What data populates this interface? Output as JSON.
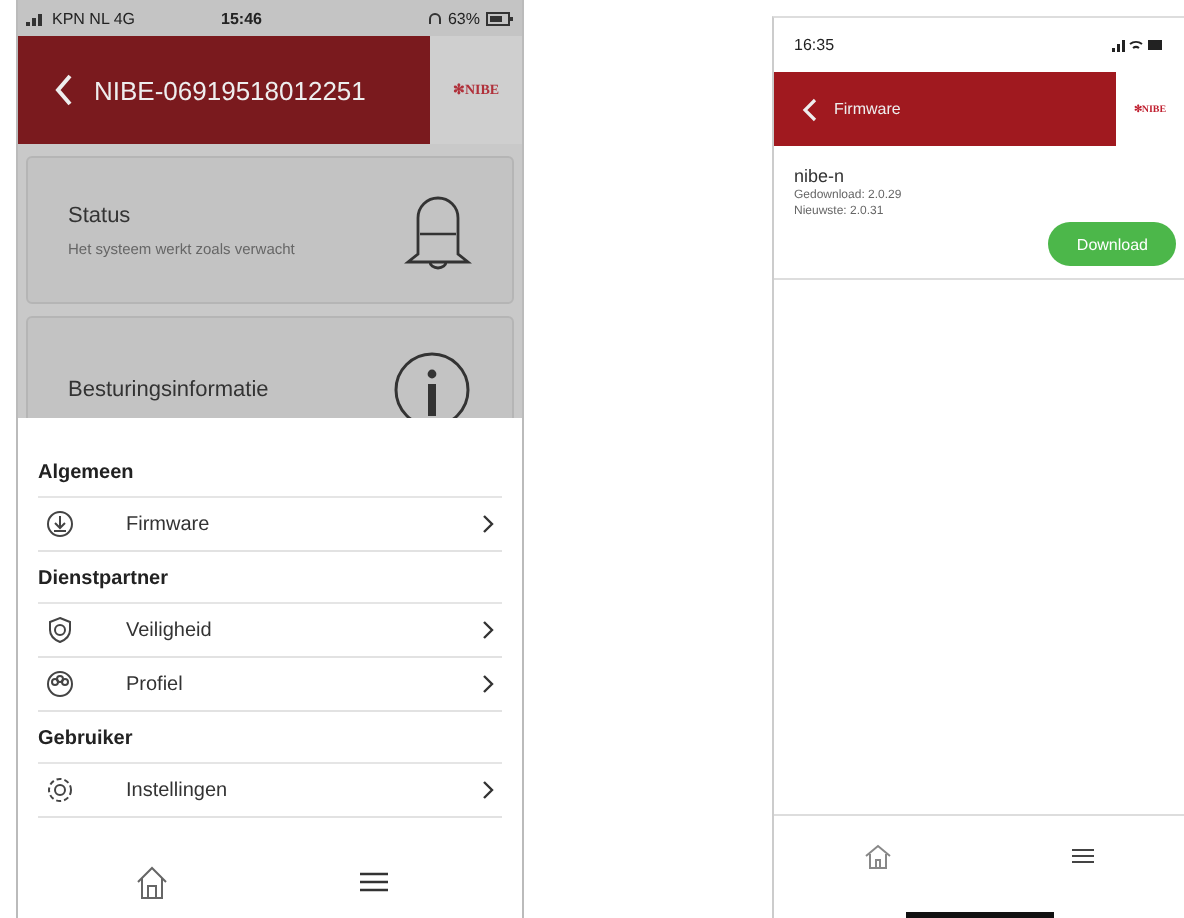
{
  "left_phone": {
    "status_bar": {
      "carrier": "KPN NL  4G",
      "time": "15:46",
      "battery": "63%"
    },
    "header": {
      "title": "NIBE-06919518012251",
      "logo": "✻NIBE"
    },
    "cards": [
      {
        "title": "Status",
        "subtitle": "Het systeem werkt zoals verwacht",
        "kind": "bell"
      },
      {
        "title": "Besturingsinformatie",
        "kind": "info"
      }
    ],
    "menu": [
      {
        "heading": "Algemeen",
        "items": [
          {
            "label": "Firmware",
            "kind": "download"
          }
        ]
      },
      {
        "heading": "Dienstpartner",
        "items": [
          {
            "label": "Veiligheid",
            "kind": "shield"
          },
          {
            "label": "Profiel",
            "kind": "people"
          }
        ]
      },
      {
        "heading": "Gebruiker",
        "items": [
          {
            "label": "Instellingen",
            "kind": "gear"
          }
        ]
      }
    ]
  },
  "right_phone": {
    "status_bar": {
      "time": "16:35"
    },
    "header": {
      "title": "Firmware",
      "logo": "✻NIBE"
    },
    "firmware": {
      "name": "nibe-n",
      "downloaded": "Gedownload: 2.0.29",
      "latest": "Nieuwste: 2.0.31",
      "button": "Download"
    }
  }
}
